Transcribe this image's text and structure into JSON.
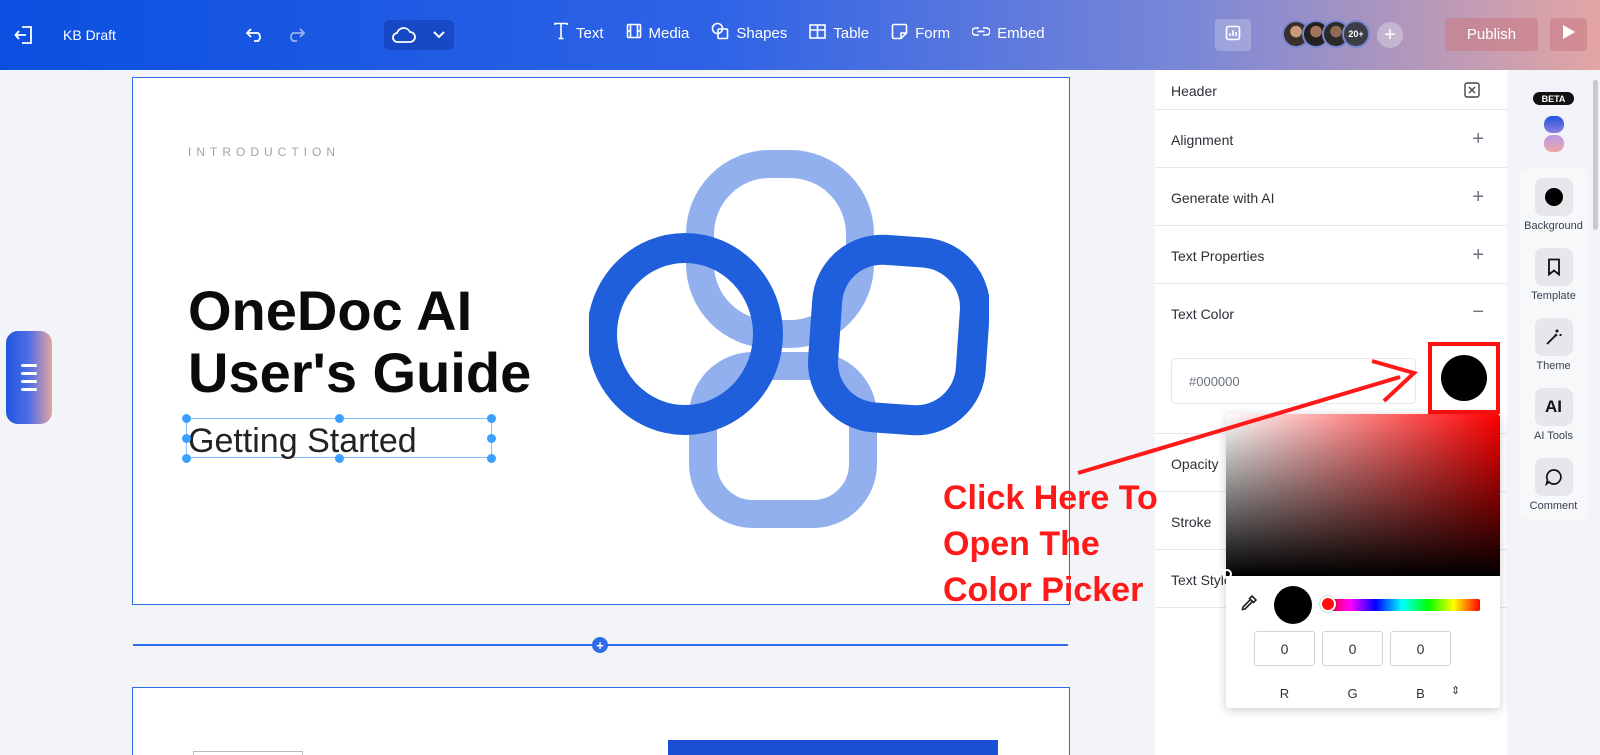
{
  "topbar": {
    "doc_title": "KB Draft",
    "tools": [
      {
        "label": "Text",
        "icon": "text-icon"
      },
      {
        "label": "Media",
        "icon": "media-icon"
      },
      {
        "label": "Shapes",
        "icon": "shapes-icon"
      },
      {
        "label": "Table",
        "icon": "table-icon"
      },
      {
        "label": "Form",
        "icon": "form-icon"
      },
      {
        "label": "Embed",
        "icon": "embed-icon"
      }
    ],
    "collaborator_count": "20+",
    "publish_label": "Publish"
  },
  "slide": {
    "kicker": "INTRODUCTION",
    "title_line1": "OneDoc AI",
    "title_line2": "User's Guide",
    "subtitle": "Getting Started"
  },
  "panel": {
    "header": "Header",
    "sections": [
      {
        "label": "Alignment",
        "action": "+"
      },
      {
        "label": "Generate with AI",
        "action": "+"
      },
      {
        "label": "Text Properties",
        "action": "+"
      },
      {
        "label": "Text Color",
        "action": "−"
      }
    ],
    "hex_value": "#000000",
    "lower_sections": [
      "Opacity",
      "Stroke",
      "Text Style"
    ],
    "accent_color": "#2f6be8"
  },
  "picker": {
    "r": "0",
    "g": "0",
    "b": "0",
    "r_label": "R",
    "g_label": "G",
    "b_label": "B",
    "selected_color": "#000000"
  },
  "annotation": {
    "line1": "Click Here To",
    "line2": "Open The",
    "line3": "Color Picker",
    "color": "#ff1a1a"
  },
  "rail": {
    "beta_label": "BETA",
    "items": [
      {
        "label": "Background",
        "icon": "background-icon"
      },
      {
        "label": "Template",
        "icon": "bookmark-icon"
      },
      {
        "label": "Theme",
        "icon": "magic-wand-icon"
      },
      {
        "label": "AI Tools",
        "icon": "ai-icon",
        "glyph": "AI"
      },
      {
        "label": "Comment",
        "icon": "comment-icon"
      }
    ]
  }
}
